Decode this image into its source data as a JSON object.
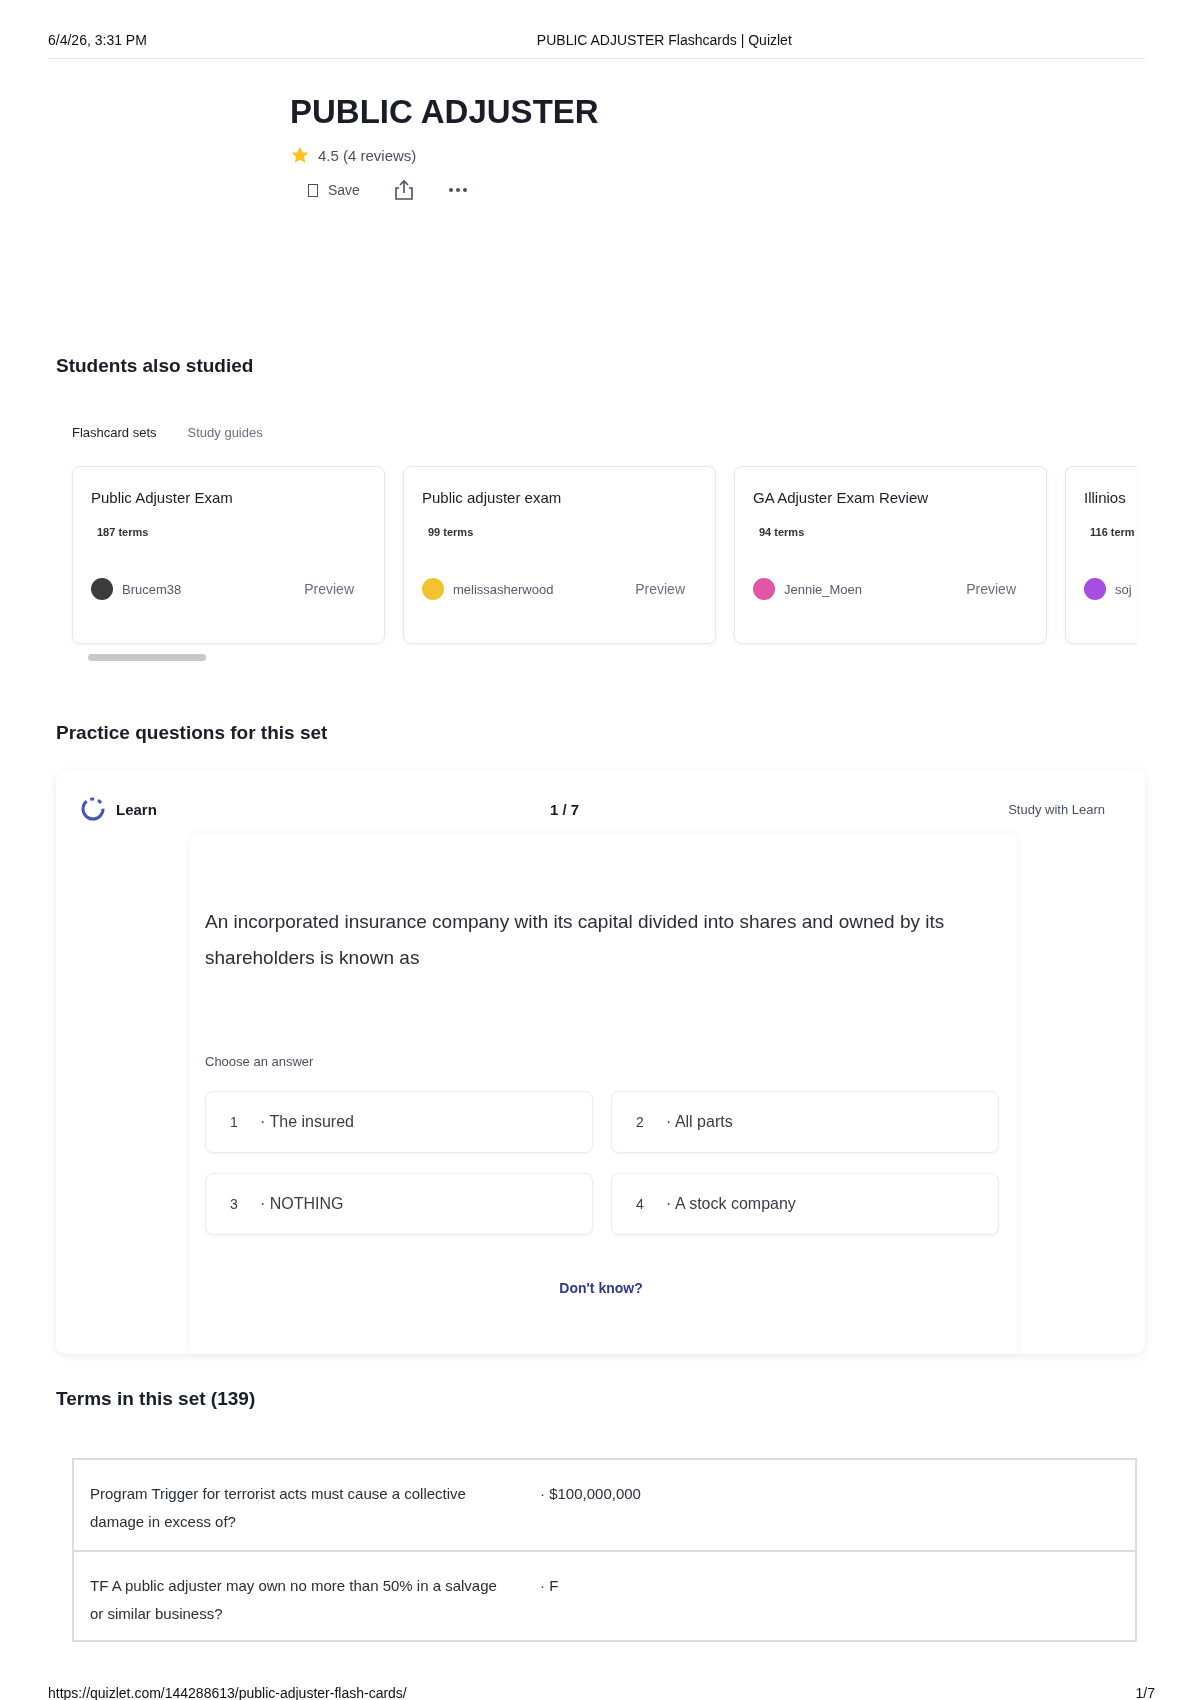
{
  "print_header": {
    "date": "6/4/26, 3:31 PM",
    "page_title": "PUBLIC ADJUSTER Flashcards | Quizlet"
  },
  "set": {
    "title": "PUBLIC ADJUSTER",
    "rating": "4.5 (4 reviews)",
    "save_label": "Save"
  },
  "also_studied": {
    "heading": "Students also studied",
    "tabs": [
      {
        "label": "Flashcard sets",
        "selected": true
      },
      {
        "label": "Study guides",
        "selected": false
      }
    ],
    "cards": [
      {
        "title": "Public Adjuster Exam",
        "terms": "187 terms",
        "author": "Brucem38",
        "color": "#3b3b3b",
        "action": "Preview"
      },
      {
        "title": "Public adjuster exam",
        "terms": "99 terms",
        "author": "melissasherwood",
        "color": "#f2c230",
        "action": "Preview"
      },
      {
        "title": "GA Adjuster Exam Review",
        "terms": "94 terms",
        "author": "Jennie_Moen",
        "color": "#e455a8",
        "action": "Preview"
      },
      {
        "title": "Illinios",
        "terms": "116 term",
        "author": "soj",
        "color": "#a64ee0"
      }
    ]
  },
  "practice": {
    "heading": "Practice questions for this set",
    "mode": "Learn",
    "progress": "1 / 7",
    "study_link": "Study with Learn",
    "question": "An incorporated insurance company with its capital divided into shares and owned by its shareholders is known as",
    "prompt": "Choose an answer",
    "answers": [
      {
        "number": "1",
        "text": "· The insured"
      },
      {
        "number": "2",
        "text": "· All parts"
      },
      {
        "number": "3",
        "text": "· NOTHING"
      },
      {
        "number": "4",
        "text": "· A stock company"
      }
    ],
    "dont_know": "Don't know?"
  },
  "terms": {
    "heading": "Terms in this set (139)",
    "rows": [
      {
        "term": "Program Trigger for terrorist acts must cause a collective damage in excess of?",
        "definition": "· $100,000,000"
      },
      {
        "term": "TF A public adjuster may own no more than 50% in a salvage or similar business?",
        "definition": "· F"
      }
    ]
  },
  "print_footer": {
    "url": "https://quizlet.com/144288613/public-adjuster-flash-cards/",
    "page": "1/7"
  }
}
